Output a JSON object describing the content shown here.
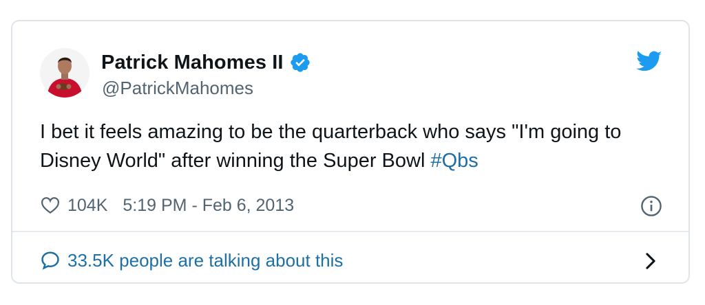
{
  "tweet": {
    "author": {
      "name": "Patrick Mahomes II",
      "handle": "@PatrickMahomes",
      "verified": true,
      "avatar_icon": "profile-photo"
    },
    "text_main": "I bet it feels amazing to be the quarterback who says \"I'm going to Disney World\" after winning the Super Bowl ",
    "hashtag": "#Qbs",
    "likes": "104K",
    "timestamp": "5:19 PM - Feb 6, 2013",
    "conversation": "33.5K people are talking about this",
    "icons": {
      "logo": "twitter-bird-icon",
      "like": "heart-icon",
      "info": "info-icon",
      "reply": "speech-bubble-icon",
      "more": "chevron-right-icon"
    },
    "colors": {
      "brand": "#1d9bf0",
      "link": "#1d6fa5",
      "text": "#0f1419",
      "secondary": "#536471"
    }
  }
}
